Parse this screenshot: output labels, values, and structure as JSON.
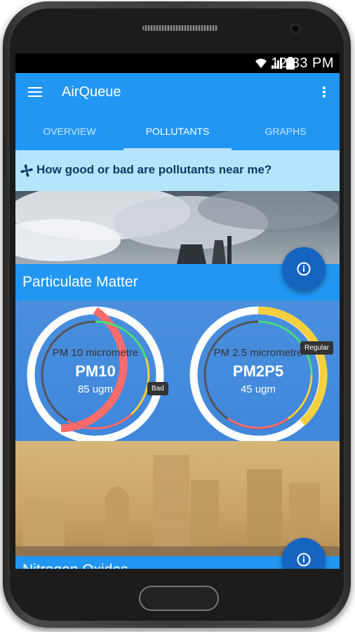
{
  "status": {
    "time": "12:33 PM"
  },
  "app": {
    "title": "AirQueue"
  },
  "tabs": [
    {
      "label": "OVERVIEW"
    },
    {
      "label": "POLLUTANTS"
    },
    {
      "label": "GRAPHS"
    }
  ],
  "question": {
    "text": "How good or bad are pollutants near me?"
  },
  "cards": {
    "particulate": {
      "title": "Particulate Matter"
    },
    "nitrogen": {
      "title": "Nitrogen Oxides"
    }
  },
  "gauges": [
    {
      "subtitle": "PM 10 micrometre",
      "name": "PM10",
      "value": "85 ugm",
      "status": "Bad",
      "status_color": "#f44336",
      "level": 0.45
    },
    {
      "subtitle": "PM 2.5 micrometre",
      "name": "PM2P5",
      "value": "45 ugm",
      "status": "Regular",
      "status_color": "#fdd835",
      "level": 0.35
    }
  ],
  "colors": {
    "primary": "#2196f3",
    "accent_dark": "#1565c0",
    "bad": "#ff6b6b",
    "regular": "#f4d03f",
    "good": "#4ade80"
  }
}
